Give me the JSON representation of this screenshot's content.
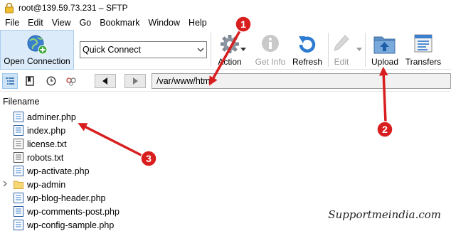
{
  "window": {
    "title": "root@139.59.73.231 – SFTP"
  },
  "menu": [
    "File",
    "Edit",
    "View",
    "Go",
    "Bookmark",
    "Window",
    "Help"
  ],
  "toolbar": {
    "open_connection": "Open Connection",
    "quick_connect": "Quick Connect",
    "action": "Action",
    "get_info": "Get Info",
    "refresh": "Refresh",
    "edit": "Edit",
    "upload": "Upload",
    "transfers": "Transfers"
  },
  "path": {
    "value": "/var/www/html"
  },
  "browser": {
    "column_header": "Filename",
    "files": [
      {
        "name": "adminer.php",
        "type": "file"
      },
      {
        "name": "index.php",
        "type": "file"
      },
      {
        "name": "license.txt",
        "type": "file"
      },
      {
        "name": "robots.txt",
        "type": "file"
      },
      {
        "name": "wp-activate.php",
        "type": "file"
      },
      {
        "name": "wp-admin",
        "type": "folder"
      },
      {
        "name": "wp-blog-header.php",
        "type": "file"
      },
      {
        "name": "wp-comments-post.php",
        "type": "file"
      },
      {
        "name": "wp-config-sample.php",
        "type": "file"
      }
    ]
  },
  "annotations": {
    "color": "#d81e1e",
    "markers": [
      "1",
      "2",
      "3"
    ]
  },
  "watermark": "Supportmeindia.com",
  "icons": [
    "lock-icon",
    "globe-plus-icon",
    "chevron-down-icon",
    "gear-icon",
    "info-icon",
    "refresh-icon",
    "pencil-icon",
    "upload-folder-icon",
    "transfers-icon",
    "outline-view-icon",
    "bookmark-icon",
    "history-icon",
    "bonjour-icon",
    "back-arrow-icon",
    "forward-arrow-icon",
    "file-icon",
    "folder-icon"
  ]
}
